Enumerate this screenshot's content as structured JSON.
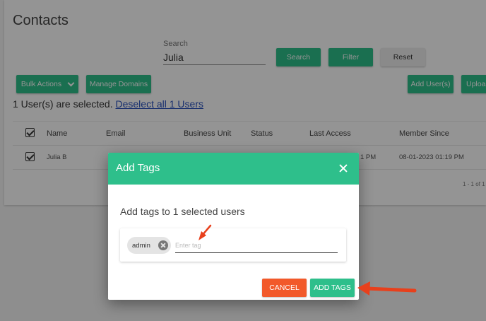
{
  "page": {
    "title": "Contacts"
  },
  "search": {
    "label": "Search",
    "value": "Julia",
    "search_button": "Search",
    "filter_button": "Filter",
    "reset_button": "Reset"
  },
  "toolbar": {
    "bulk_actions": "Bulk Actions",
    "manage_domains": "Manage Domains",
    "add_users": "Add User(s)",
    "upload": "Uploa"
  },
  "selection": {
    "text": "1 User(s) are selected. ",
    "deselect_link": "Deselect all 1 Users"
  },
  "table": {
    "headers": [
      "Name",
      "Email",
      "Business Unit",
      "Status",
      "Last Access",
      "Member Since"
    ],
    "rows": [
      {
        "name": "Julia B",
        "last_access_partial": "1 PM",
        "member_since": "08-01-2023 01:19 PM"
      }
    ],
    "pager": "1 - 1 of 1"
  },
  "modal": {
    "title": "Add Tags",
    "subtitle": "Add tags to 1 selected users",
    "tags": [
      {
        "label": "admin"
      }
    ],
    "input_placeholder": "Enter tag",
    "input_value": "",
    "cancel_button": "CANCEL",
    "add_tags_button": "ADD TAGS"
  },
  "colors": {
    "primary_green": "#2ebf8b",
    "cancel_orange": "#f2592a",
    "annotation_red": "#e8401c",
    "link_blue": "#2a52be"
  }
}
